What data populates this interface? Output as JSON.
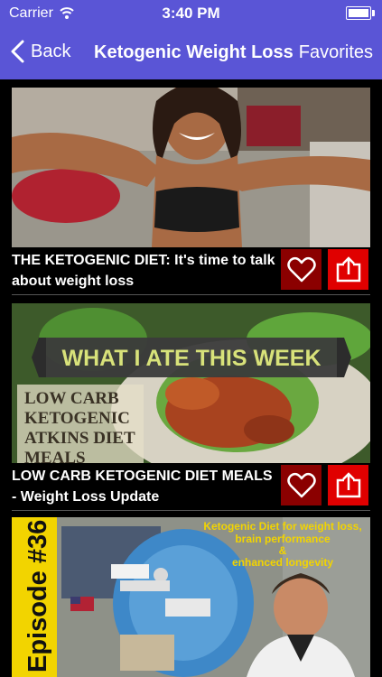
{
  "status_bar": {
    "carrier": "Carrier",
    "time": "3:40 PM"
  },
  "nav": {
    "back_label": "Back",
    "title": "Ketogenic Weight Loss",
    "favorites_label": "Favorites"
  },
  "videos": [
    {
      "title": "THE KETOGENIC DIET: It's time to talk about weight loss"
    },
    {
      "title": "LOW CARB KETOGENIC DIET MEALS - Weight Loss Update",
      "thumb_text": {
        "banner": "WHAT I ATE THIS WEEK",
        "line1": "LOW CARB",
        "line2": "KETOGENIC",
        "line3": "ATKINS DIET",
        "line4": "MEALS"
      }
    },
    {
      "title": "",
      "thumb_text": {
        "episode": "Episode #36",
        "caption1": "Ketogenic Diet for weight loss,",
        "caption2": "brain performance",
        "caption3": "&",
        "caption4": "enhanced longevity"
      }
    }
  ],
  "colors": {
    "nav_bg": "#5a55d6",
    "favorite_bg": "#8b0000",
    "share_bg": "#e00000"
  },
  "icons": {
    "back": "chevron-left-icon",
    "wifi": "wifi-icon",
    "battery": "battery-icon",
    "favorite": "heart-outline-icon",
    "share": "share-icon"
  }
}
